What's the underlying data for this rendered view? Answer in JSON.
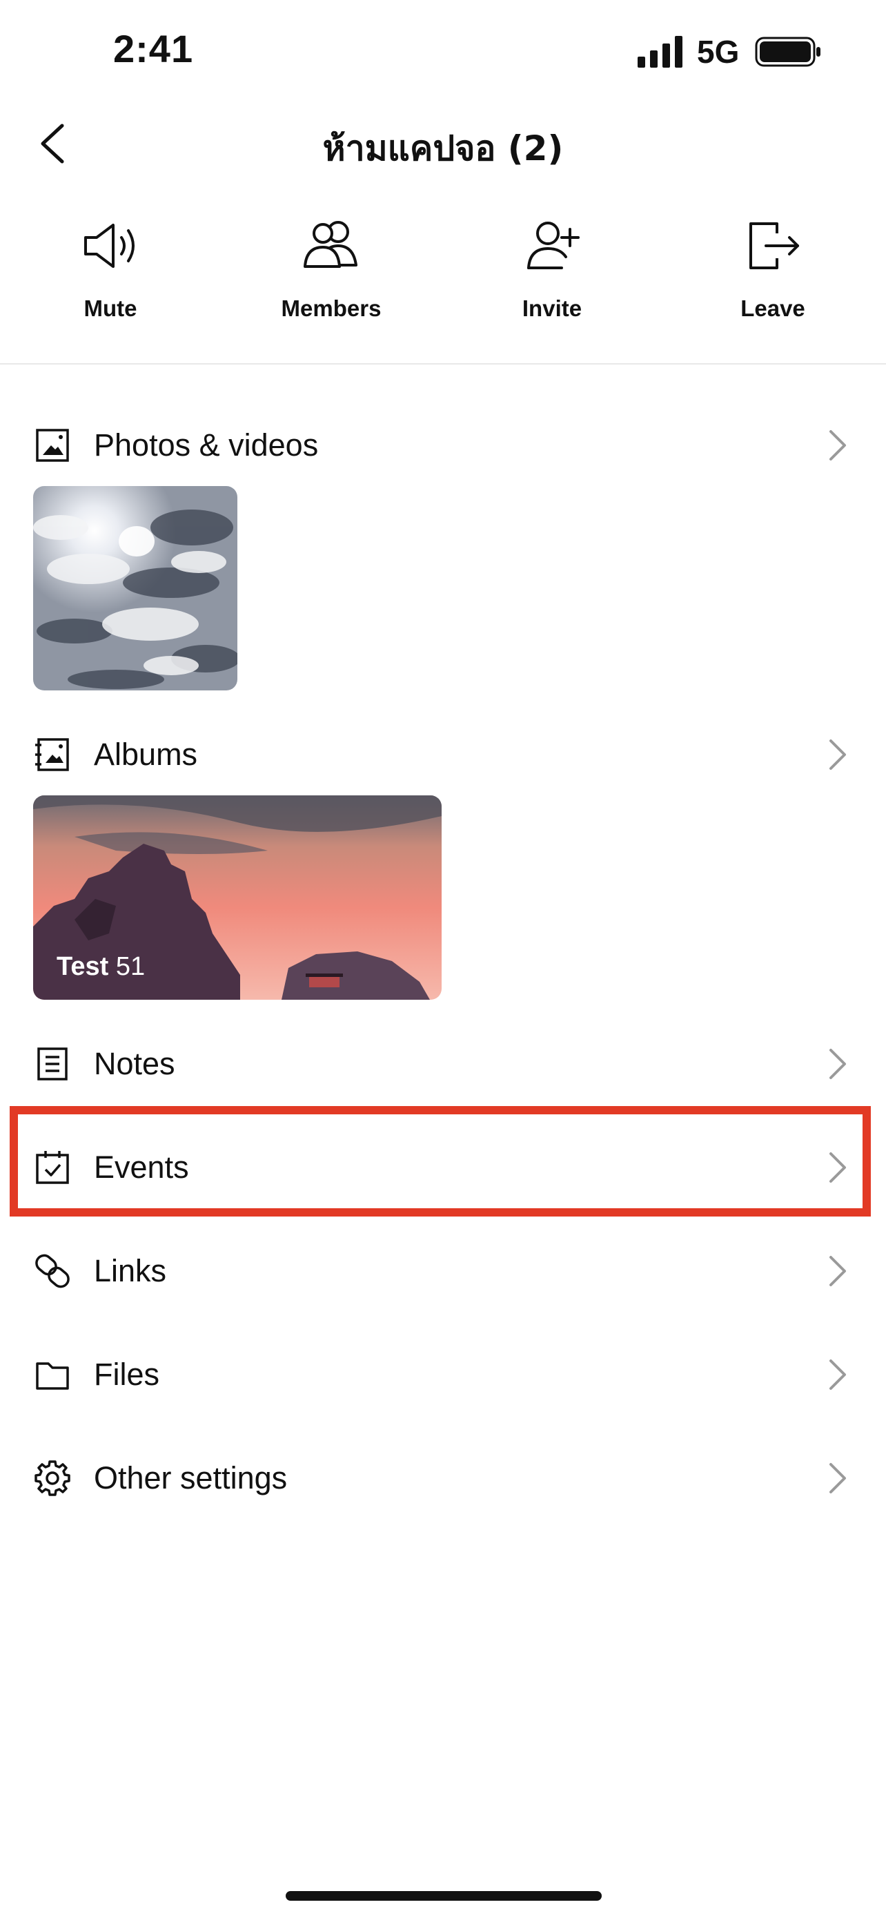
{
  "status_bar": {
    "time": "2:41",
    "network": "5G"
  },
  "header": {
    "title": "ห้ามแคปจอ (2)"
  },
  "actions": [
    {
      "label": "Mute",
      "icon": "speaker-icon"
    },
    {
      "label": "Members",
      "icon": "members-icon"
    },
    {
      "label": "Invite",
      "icon": "add-person-icon"
    },
    {
      "label": "Leave",
      "icon": "leave-icon"
    }
  ],
  "sections": {
    "photos": {
      "label": "Photos & videos",
      "icon": "photo-icon"
    },
    "albums": {
      "label": "Albums",
      "icon": "album-icon",
      "album_name": "Test",
      "album_count": "51"
    },
    "notes": {
      "label": "Notes",
      "icon": "note-icon"
    },
    "events": {
      "label": "Events",
      "icon": "calendar-check-icon"
    },
    "links": {
      "label": "Links",
      "icon": "link-icon"
    },
    "files": {
      "label": "Files",
      "icon": "folder-icon"
    },
    "other": {
      "label": "Other settings",
      "icon": "gear-icon"
    }
  },
  "colors": {
    "highlight": "#e23a25",
    "chevron": "#9a9a9a"
  }
}
